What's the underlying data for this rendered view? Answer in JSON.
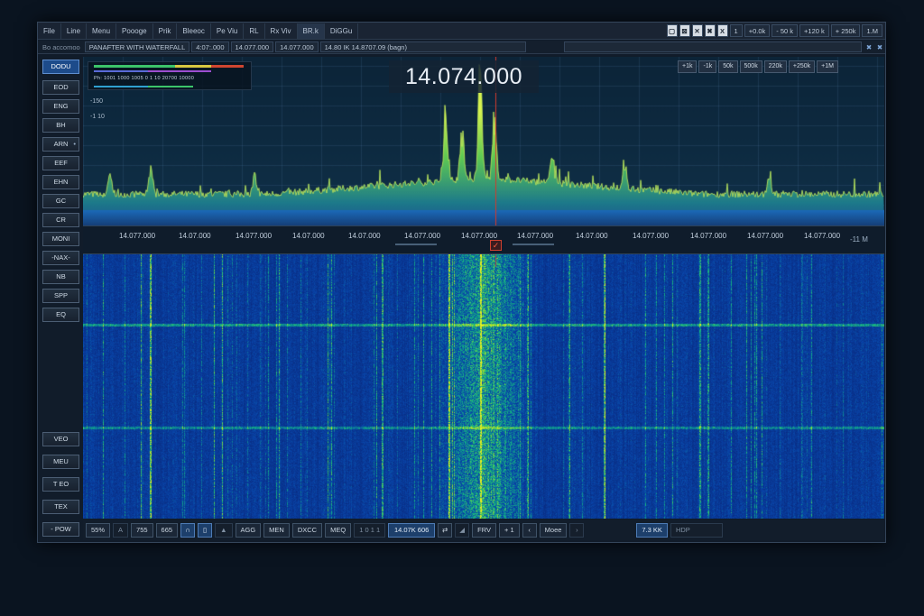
{
  "menubar": {
    "items": [
      "File",
      "Line",
      "Menu",
      "Poooge",
      "Prik",
      "Bleeoc",
      "Pe Viu",
      "RL",
      "Rx Viv",
      "BR.k",
      "DiGGu"
    ],
    "right_buttons": [
      "+0.0k",
      "- 50 k",
      "+120 k",
      "+ 250k",
      "1.M"
    ],
    "right_num": "1"
  },
  "toolbar": {
    "label": "Bo accomoo",
    "view_name": "PANAFTER WITH WATERFALL",
    "field_a": "4:07:.000",
    "field_b": "14.077.000",
    "field_c": "14.077.000",
    "field_d": "14.80 IK 14.8707.09 (bagn)",
    "close_glyphs": [
      "✖",
      "✖"
    ]
  },
  "sidebar": {
    "top_buttons": [
      "DODU",
      "EOD",
      "ENG",
      "BH",
      "ARN",
      "EEF",
      "EHN",
      "GC",
      "CR",
      "MONI",
      "-NAX-",
      "NB",
      "SPP",
      "EQ"
    ],
    "bottom_buttons": [
      "VEO",
      "MEU",
      "T EO",
      "TEX",
      "- POW"
    ]
  },
  "display": {
    "big_frequency": "14.074.000",
    "legend_text": "Ph: 1001  1000  1005  0  1 10   20700 10000",
    "db_labels": [
      "-150",
      "-1 10"
    ],
    "span_buttons": [
      "+1k",
      "-1k",
      "50k",
      "500k",
      "220k",
      "+250k",
      "+1M"
    ],
    "freq_ticks": [
      "14.077.000",
      "14.07.000",
      "14.077.000",
      "14.07.000",
      "14.07.000",
      "14.077.000",
      "14.077.000",
      "14.077.000",
      "14.07.000",
      "14.077.000",
      "14.077.000",
      "14.077.000",
      "14.077.000"
    ],
    "freq_end": "-11 M",
    "marker_glyph": "✓"
  },
  "bottombar": {
    "items": [
      "55%",
      "A",
      "755",
      "665",
      "∩",
      "▯",
      "▲",
      "AGG",
      "MEN",
      "DXCC",
      "MEQ",
      "1 0 1 1",
      "14.07K 606",
      "⇄",
      "◢",
      "FRV",
      "+ 1",
      "‹",
      "Moee",
      "›",
      "7.3 KK",
      "HDP"
    ]
  },
  "colors": {
    "accent": "#1d4b8a",
    "spectrum_fill": "#2f8b5a",
    "spectrum_peak": "#d7f25a",
    "waterfall_base": "#0b2f8c",
    "marker_line": "#d33a2c"
  }
}
